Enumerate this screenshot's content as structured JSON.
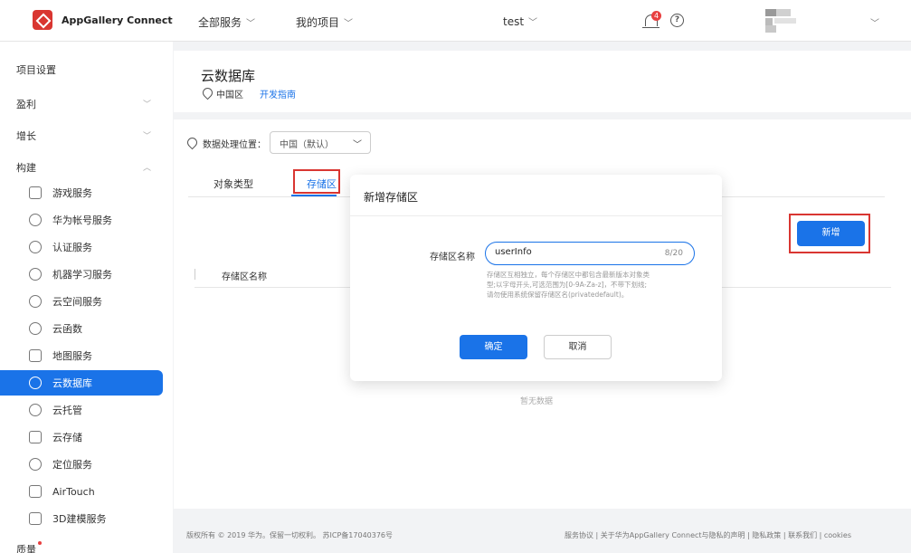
{
  "header": {
    "logo_text": "AppGallery Connect",
    "nav_all_services": "全部服务",
    "nav_my_projects": "我的项目",
    "project_name": "test",
    "notification_count": "4",
    "help_glyph": "?"
  },
  "sidebar": {
    "project_settings": "项目设置",
    "monetize": "盈利",
    "growth": "增长",
    "build": "构建",
    "items": [
      {
        "label": "游戏服务",
        "icon": "game-icon"
      },
      {
        "label": "华为帐号服务",
        "icon": "account-icon"
      },
      {
        "label": "认证服务",
        "icon": "auth-icon"
      },
      {
        "label": "机器学习服务",
        "icon": "ml-icon"
      },
      {
        "label": "云空间服务",
        "icon": "cloud-space-icon"
      },
      {
        "label": "云函数",
        "icon": "cloud-function-icon"
      },
      {
        "label": "地图服务",
        "icon": "map-icon"
      },
      {
        "label": "云数据库",
        "icon": "database-icon",
        "active": true
      },
      {
        "label": "云托管",
        "icon": "hosting-icon"
      },
      {
        "label": "云存储",
        "icon": "storage-icon"
      },
      {
        "label": "定位服务",
        "icon": "location-icon"
      },
      {
        "label": "AirTouch",
        "icon": "airtouch-icon"
      },
      {
        "label": "3D建模服务",
        "icon": "3d-modeling-icon"
      }
    ],
    "quality": "质量"
  },
  "page": {
    "title": "云数据库",
    "region": "中国区",
    "dev_guide": "开发指南",
    "location_label": "数据处理位置：",
    "location_value": "中国（默认）",
    "tabs": [
      "对象类型",
      "存储区"
    ],
    "add_button": "新增",
    "column_name": "存储区名称",
    "empty_text": "暂无数据"
  },
  "dialog": {
    "title": "新增存储区",
    "field_label": "存储区名称",
    "field_value": "userInfo",
    "counter": "8/20",
    "hint_lines": [
      "存储区互相独立，每个存储区中都包含最新版本对象类",
      "型;以字母开头,可选范围为[0-9A-Za-z]，不带下划线;",
      "请勿使用系统保留存储区名(privatedefault)。"
    ],
    "confirm": "确定",
    "cancel": "取消"
  },
  "footer": {
    "left": "版权所有 © 2019 华为。保留一切权利。 苏ICP备17040376号",
    "right": "服务协议 | 关于华为AppGallery Connect与隐私的声明 | 隐私政策 | 联系我们 | cookies"
  },
  "colors": {
    "primary": "#1a73e8",
    "highlight": "#d93631",
    "badge": "#e84040"
  }
}
